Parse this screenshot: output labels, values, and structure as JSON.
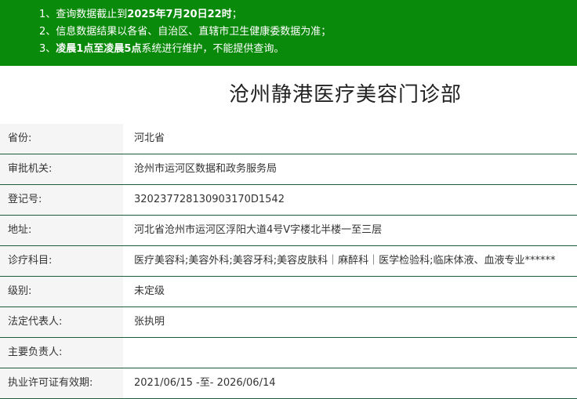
{
  "notice": {
    "line1_prefix": "1、查询数据截止到",
    "line1_bold": "2025年7月20日22时",
    "line1_suffix": "；",
    "line2": "2、信息数据结果以各省、自治区、直辖市卫生健康委数据为准；",
    "line3_prefix": "3、",
    "line3_bold": "凌晨1点至凌晨5点",
    "line3_suffix": "系统进行维护，不能提供查询。"
  },
  "title": "沧州静港医疗美容门诊部",
  "fields": [
    {
      "label": "省份:",
      "value": "河北省"
    },
    {
      "label": "审批机关:",
      "value": "沧州市运河区数据和政务服务局"
    },
    {
      "label": "登记号:",
      "value": "320237728130903170D1542"
    },
    {
      "label": "地址:",
      "value": "河北省沧州市运河区浮阳大道4号V字楼北半楼一至三层"
    },
    {
      "label": "诊疗科目:",
      "value": "医疗美容科;美容外科;美容牙科;美容皮肤科｜麻醉科｜医学检验科;临床体液、血液专业******"
    },
    {
      "label": "级别:",
      "value": "未定级"
    },
    {
      "label": "法定代表人:",
      "value": "张执明"
    },
    {
      "label": "主要负责人:",
      "value": ""
    },
    {
      "label": "执业许可证有效期:",
      "value": "2021/06/15 -至- 2026/06/14"
    }
  ]
}
